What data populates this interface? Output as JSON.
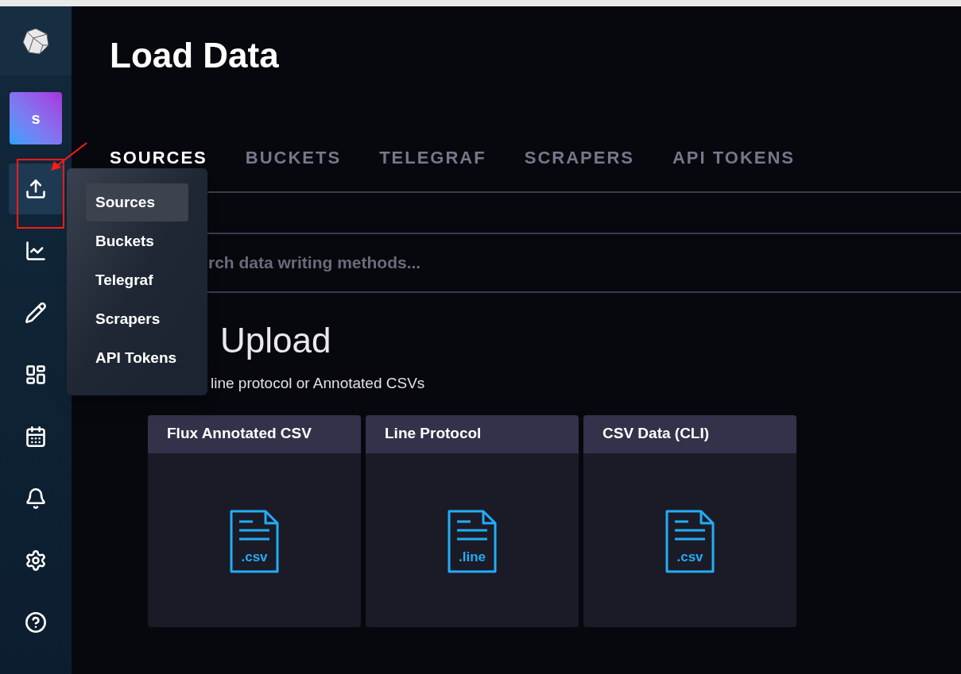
{
  "sidebar": {
    "avatar": "s",
    "items": [
      {
        "kind": "upload",
        "selected": true
      },
      {
        "kind": "chart",
        "selected": false
      },
      {
        "kind": "pencil",
        "selected": false
      },
      {
        "kind": "dashboard",
        "selected": false
      },
      {
        "kind": "calendar",
        "selected": false
      },
      {
        "kind": "bell",
        "selected": false
      },
      {
        "kind": "gear",
        "selected": false
      },
      {
        "kind": "help",
        "selected": false
      }
    ]
  },
  "flyout_menu": [
    {
      "label": "Sources",
      "selected": true
    },
    {
      "label": "Buckets",
      "selected": false
    },
    {
      "label": "Telegraf",
      "selected": false
    },
    {
      "label": "Scrapers",
      "selected": false
    },
    {
      "label": "API Tokens",
      "selected": false
    }
  ],
  "page_title": "Load Data",
  "tabs": [
    {
      "label": "SOURCES",
      "selected": true
    },
    {
      "label": "BUCKETS",
      "selected": false
    },
    {
      "label": "TELEGRAF",
      "selected": false
    },
    {
      "label": "SCRAPERS",
      "selected": false
    },
    {
      "label": "API TOKENS",
      "selected": false
    }
  ],
  "search": {
    "placeholder": "rch data writing methods..."
  },
  "section": {
    "heading": "Upload",
    "description": "line protocol or Annotated CSVs"
  },
  "cards": [
    {
      "title": "Flux Annotated CSV",
      "file_label": ".csv"
    },
    {
      "title": "Line Protocol",
      "file_label": ".line"
    },
    {
      "title": "CSV Data (CLI)",
      "file_label": ".csv"
    }
  ]
}
